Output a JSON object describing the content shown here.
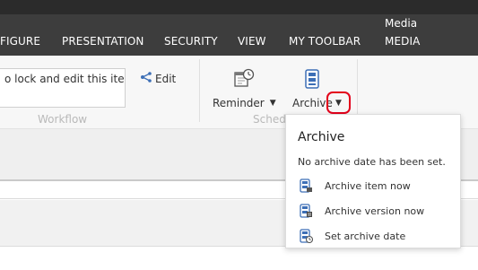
{
  "ribbon": {
    "context_tab_group": "Media",
    "tabs": [
      "FIGURE",
      "PRESENTATION",
      "SECURITY",
      "VIEW",
      "MY TOOLBAR",
      "MEDIA"
    ]
  },
  "workflow": {
    "notice": "o lock and edit this item.",
    "edit_label": "Edit",
    "group_label": "Workflow"
  },
  "schedule": {
    "reminder_label": "Reminder",
    "archive_label": "Archive",
    "group_label": "Schedu"
  },
  "archive_dropdown": {
    "title": "Archive",
    "message": "No archive date has been set.",
    "items": [
      {
        "label": "Archive item now",
        "icon": "archive-item-icon"
      },
      {
        "label": "Archive version now",
        "icon": "archive-version-icon"
      },
      {
        "label": "Set archive date",
        "icon": "set-archive-date-icon"
      }
    ]
  },
  "colors": {
    "ribbon_tabs_bg": "#3d3d3d",
    "top_strip_bg": "#2b2b2b",
    "highlight_red": "#e3001b",
    "icon_blue": "#3d6fb6"
  }
}
